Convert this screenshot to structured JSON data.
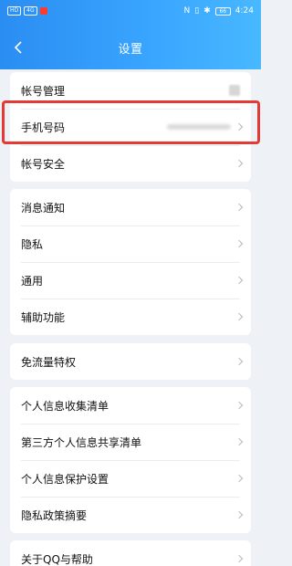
{
  "status_bar": {
    "left_chips": [
      "HD",
      "4G"
    ],
    "battery": "66",
    "time": "4:24"
  },
  "header": {
    "title": "设置"
  },
  "sections": [
    {
      "items": [
        {
          "label": "帐号管理",
          "trailing": "blurred-avatar"
        },
        {
          "label": "手机号码",
          "trailing": "blurred-phone"
        },
        {
          "label": "帐号安全",
          "trailing": "chevron"
        }
      ]
    },
    {
      "items": [
        {
          "label": "消息通知"
        },
        {
          "label": "隐私"
        },
        {
          "label": "通用"
        },
        {
          "label": "辅助功能"
        }
      ]
    },
    {
      "items": [
        {
          "label": "免流量特权"
        }
      ]
    },
    {
      "items": [
        {
          "label": "个人信息收集清单"
        },
        {
          "label": "第三方个人信息共享清单"
        },
        {
          "label": "个人信息保护设置"
        },
        {
          "label": "隐私政策摘要"
        }
      ]
    },
    {
      "items": [
        {
          "label": "关于QQ与帮助"
        }
      ]
    }
  ],
  "colors": {
    "header_gradient_start": "#2a8df2",
    "header_gradient_end": "#48b8ff",
    "page_background": "#eef1f6",
    "highlight_border": "#e53935"
  },
  "icons": {
    "back": "chevron-left-icon",
    "row_arrow": "chevron-right-icon"
  }
}
